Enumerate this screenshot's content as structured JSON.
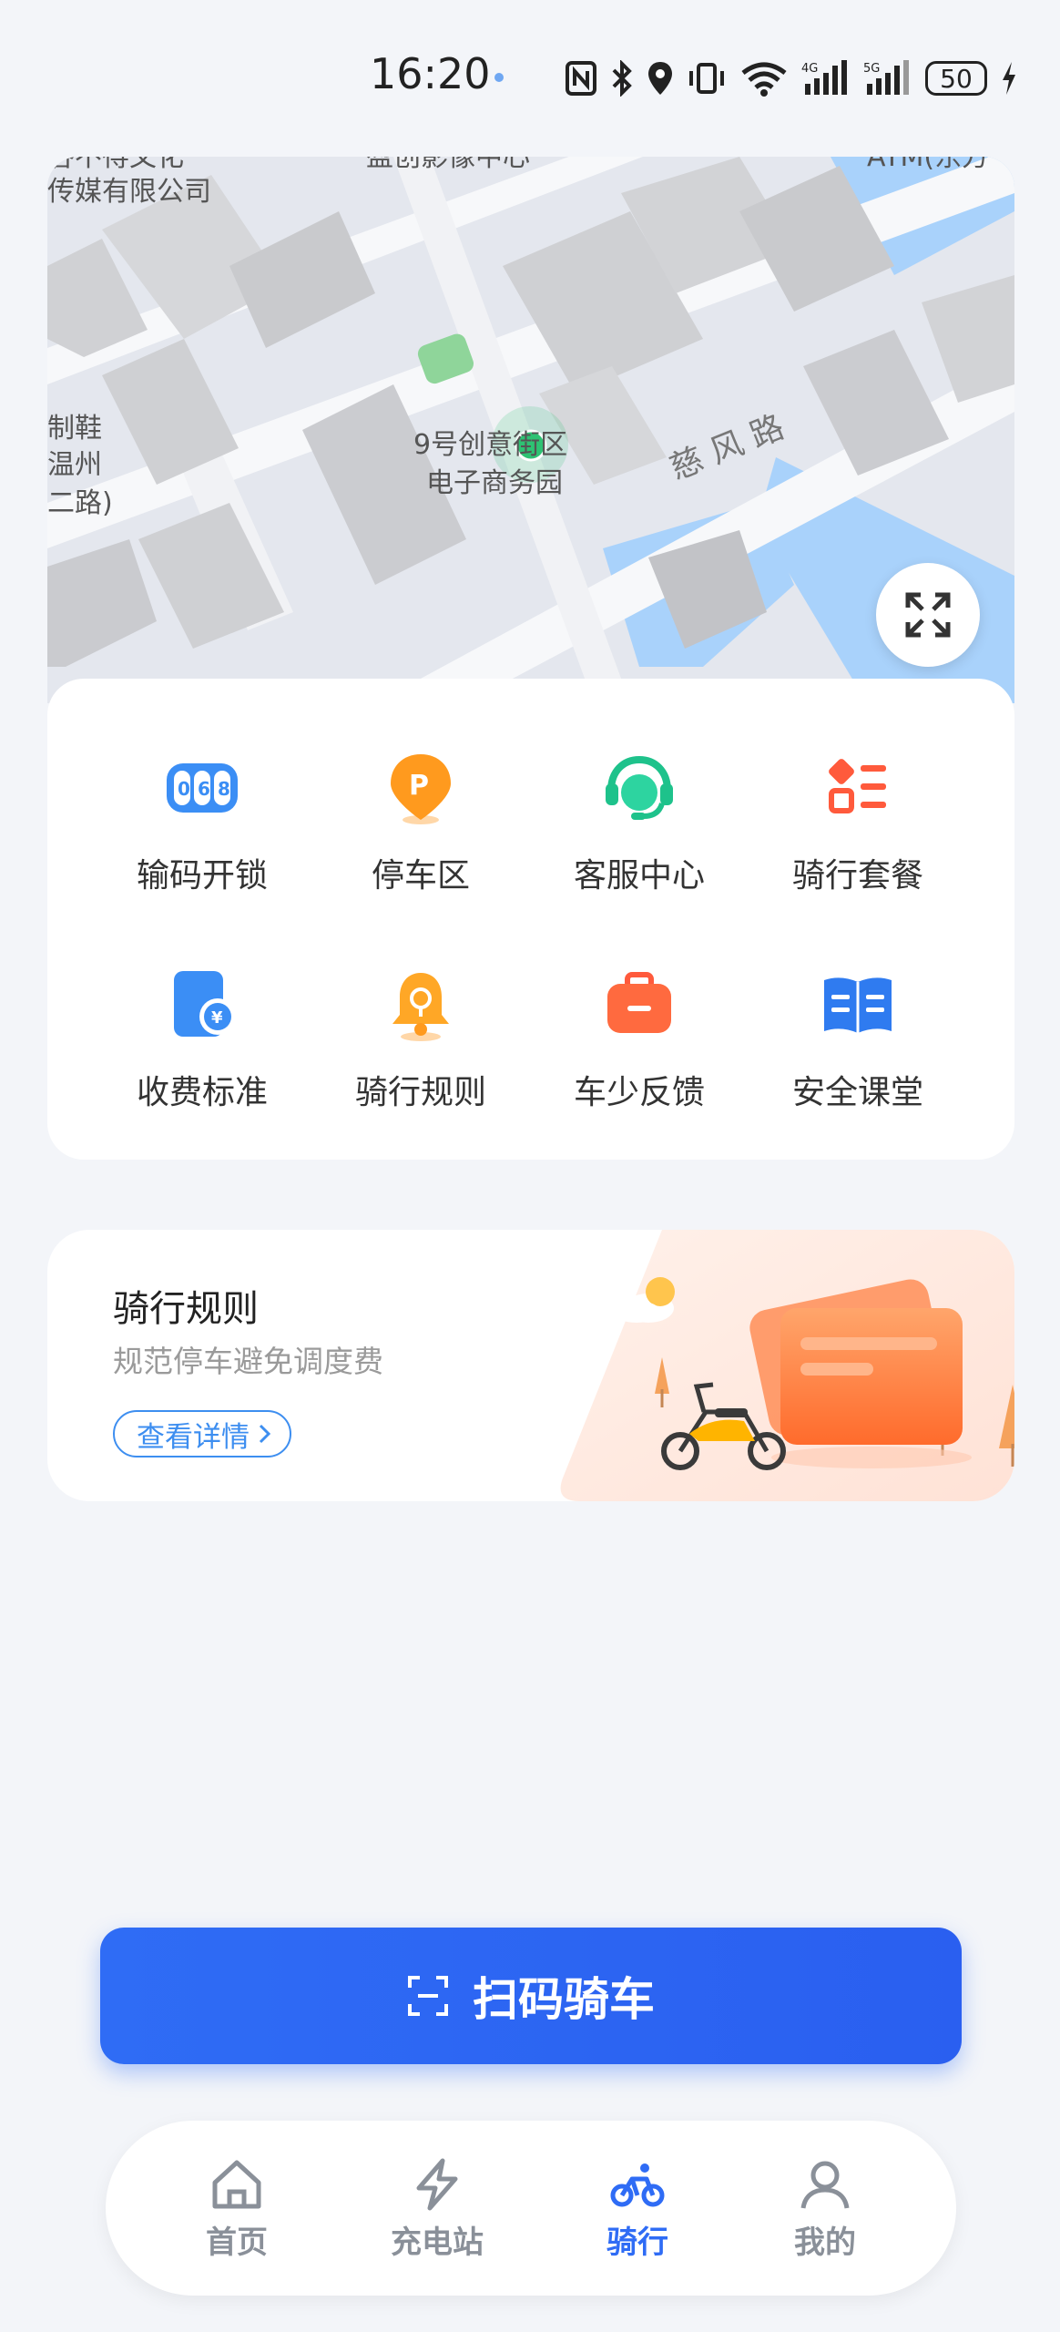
{
  "status_bar": {
    "time": "16:20",
    "battery": "50"
  },
  "map": {
    "labels": {
      "top_left_1": "谷不得文化",
      "top_left_2": "传媒有限公司",
      "top_center": "盈创影像中心",
      "top_right": "ATM(东方",
      "left_1": "制鞋",
      "left_2": "温州",
      "left_3": "二路)",
      "park_1": "9号创意街区",
      "park_2": "电子商务园",
      "road": "慈 风 路"
    }
  },
  "actions": [
    {
      "label": "输码开锁",
      "icon": "code-unlock-icon"
    },
    {
      "label": "停车区",
      "icon": "parking-icon"
    },
    {
      "label": "客服中心",
      "icon": "customer-service-icon"
    },
    {
      "label": "骑行套餐",
      "icon": "package-icon"
    },
    {
      "label": "收费标准",
      "icon": "fee-icon"
    },
    {
      "label": "骑行规则",
      "icon": "bell-icon"
    },
    {
      "label": "车少反馈",
      "icon": "feedback-icon"
    },
    {
      "label": "安全课堂",
      "icon": "book-icon"
    }
  ],
  "banner": {
    "title": "骑行规则",
    "subtitle": "规范停车避免调度费",
    "button": "查看详情"
  },
  "scan_button": {
    "label": "扫码骑车"
  },
  "nav": [
    {
      "label": "首页",
      "icon": "home-icon"
    },
    {
      "label": "充电站",
      "icon": "lightning-icon"
    },
    {
      "label": "骑行",
      "icon": "bike-icon"
    },
    {
      "label": "我的",
      "icon": "user-icon"
    }
  ],
  "colors": {
    "accent": "#2f6cf5",
    "map_marker": "#2ec273"
  }
}
